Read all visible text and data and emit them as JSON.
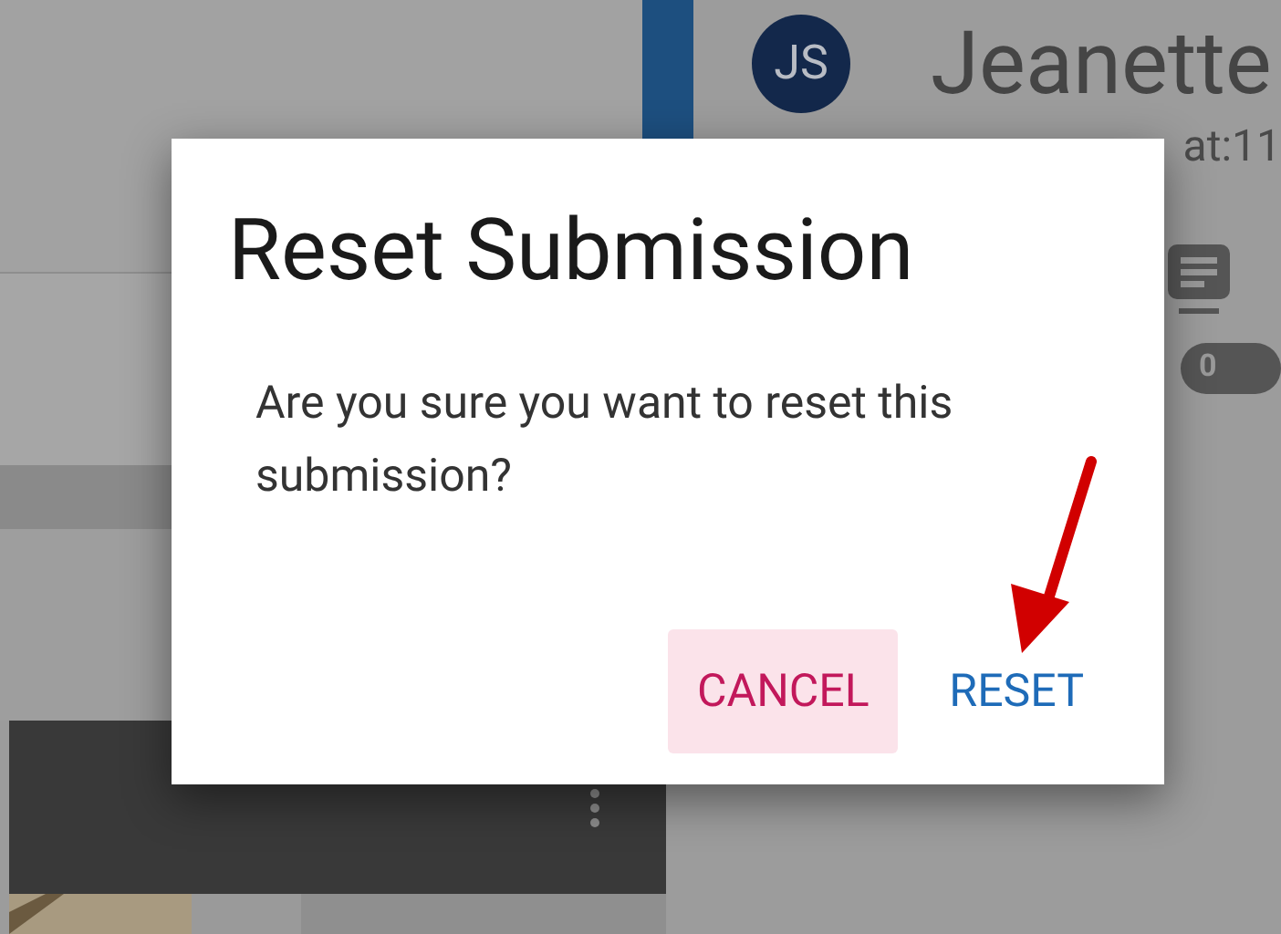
{
  "background": {
    "avatar_initials": "JS",
    "user_name": "Jeanette",
    "submitted_fragment": "at:11",
    "comment_count": "0"
  },
  "dialog": {
    "title": "Reset Submission",
    "message": "Are you sure you want to reset this submission?",
    "buttons": [
      {
        "label": "CANCEL",
        "kind": "cancel"
      },
      {
        "label": "RESET",
        "kind": "confirm"
      }
    ]
  }
}
